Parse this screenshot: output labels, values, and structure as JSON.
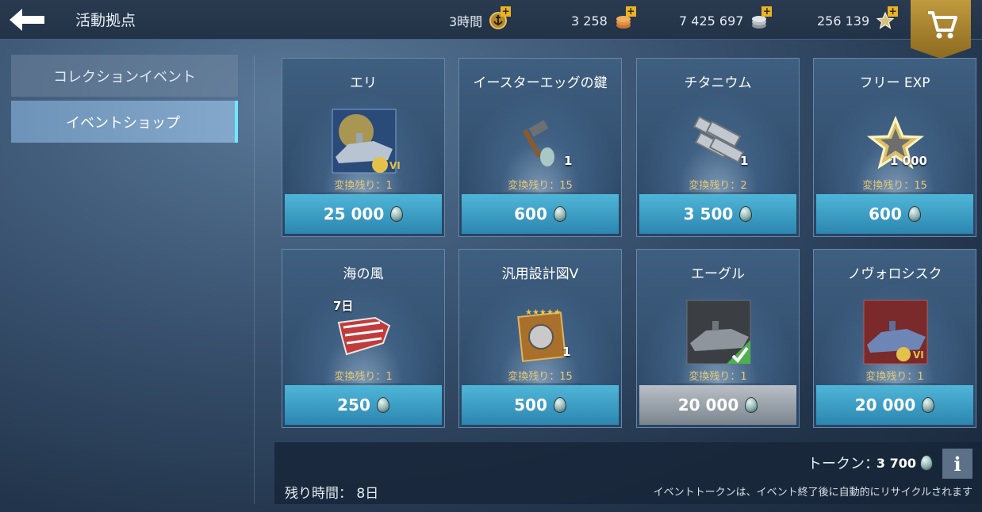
{
  "header": {
    "title": "活動拠点",
    "resources": [
      {
        "value": "3時間",
        "icon": "premium-anchor-icon"
      },
      {
        "value": "3 258",
        "icon": "doubloons-icon"
      },
      {
        "value": "7 425 697",
        "icon": "credits-icon"
      },
      {
        "value": "256 139",
        "icon": "free-exp-star-icon"
      }
    ],
    "plus": "+"
  },
  "sidebar": {
    "items": [
      {
        "label": "コレクションイベント",
        "active": false
      },
      {
        "label": "イベントショップ",
        "active": true
      }
    ]
  },
  "shop": {
    "items": [
      {
        "name": "エリ",
        "qty": "",
        "remaining": "変換残り：1",
        "price": "25 000",
        "art": "ship-eri-icon",
        "tier": "VI",
        "owned": false
      },
      {
        "name": "イースターエッグの鍵",
        "qty": "1",
        "remaining": "変換残り：15",
        "price": "600",
        "art": "hammer-egg-icon",
        "owned": false
      },
      {
        "name": "チタニウム",
        "qty": "1",
        "remaining": "変換残り：2",
        "price": "3 500",
        "art": "titanium-bars-icon",
        "owned": false
      },
      {
        "name": "フリー EXP",
        "qty": "1 000",
        "remaining": "変換残り：15",
        "price": "600",
        "art": "free-exp-star-icon",
        "owned": false
      },
      {
        "name": "海の風",
        "qty": "7日",
        "remaining": "変換残り：1",
        "price": "250",
        "art": "camouflage-icon",
        "owned": false
      },
      {
        "name": "汎用設計図V",
        "qty": "1",
        "remaining": "変換残り：15",
        "price": "500",
        "art": "blueprint-icon",
        "owned": false
      },
      {
        "name": "エーグル",
        "qty": "",
        "remaining": "変換残り：1",
        "price": "20 000",
        "art": "ship-aigle-icon",
        "owned": true
      },
      {
        "name": "ノヴォロシスク",
        "qty": "",
        "remaining": "変換残り：1",
        "price": "20 000",
        "art": "ship-novorossiysk-icon",
        "tier": "VI",
        "owned": false
      }
    ]
  },
  "footer": {
    "token_label": "トークン：",
    "token_value": "3 700",
    "info": "i",
    "time_left": "残り時間： 8日",
    "notice": "イベントトークンは、イベント終了後に自動的にリサイクルされます"
  }
}
